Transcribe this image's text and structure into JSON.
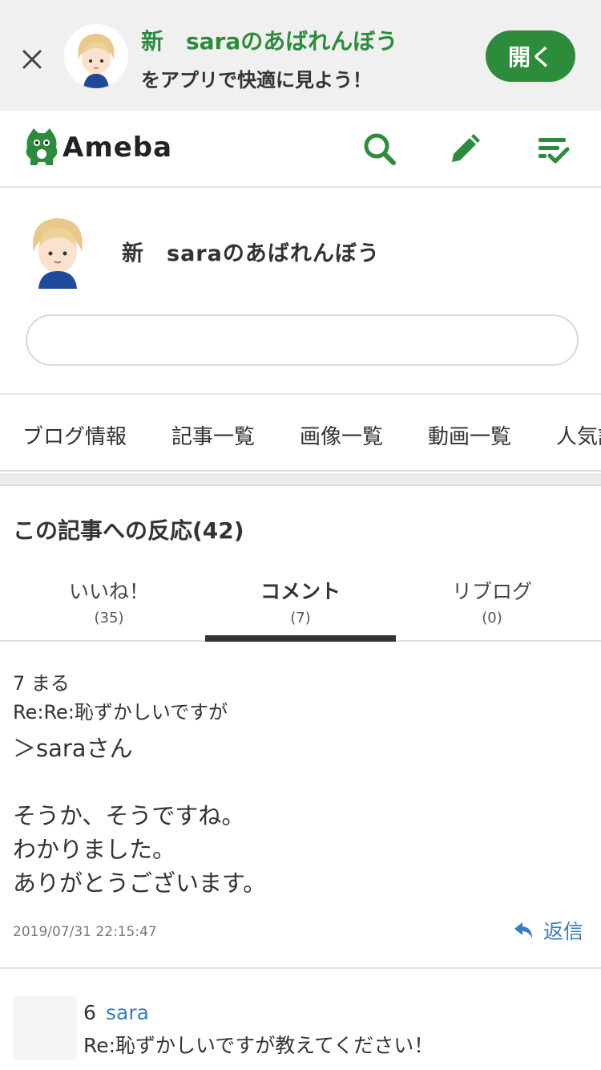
{
  "banner": {
    "blog_title": "新　saraのあばれんぼう",
    "subtitle": "をアプリで快適に見よう！",
    "open_label": "開く"
  },
  "header": {
    "logo_text": "Ameba"
  },
  "profile": {
    "name": "新　saraのあばれんぼう"
  },
  "nav": {
    "items": [
      "ブログ情報",
      "記事一覧",
      "画像一覧",
      "動画一覧",
      "人気記"
    ]
  },
  "reactions": {
    "title": "この記事への反応(42)",
    "tabs": [
      {
        "label": "いいね！",
        "count": "(35)"
      },
      {
        "label": "コメント",
        "count": "(7)"
      },
      {
        "label": "リブログ",
        "count": "(0)"
      }
    ],
    "active_tab": "コメント"
  },
  "comments": [
    {
      "number": "7",
      "author": "まる",
      "header": "7  まる",
      "title": "Re:Re:恥ずかしいですが",
      "body": "＞saraさん\n\nそうか、そうですね。\nわかりました。\nありがとうございます。",
      "date": "2019/07/31 22:15:47",
      "reply_label": "返信"
    },
    {
      "number": "6",
      "author": "sara",
      "title": "Re:恥ずかしいですが教えてください！"
    }
  ],
  "colors": {
    "ameba_green": "#2d8c3c",
    "link_blue": "#3b7bbf"
  }
}
